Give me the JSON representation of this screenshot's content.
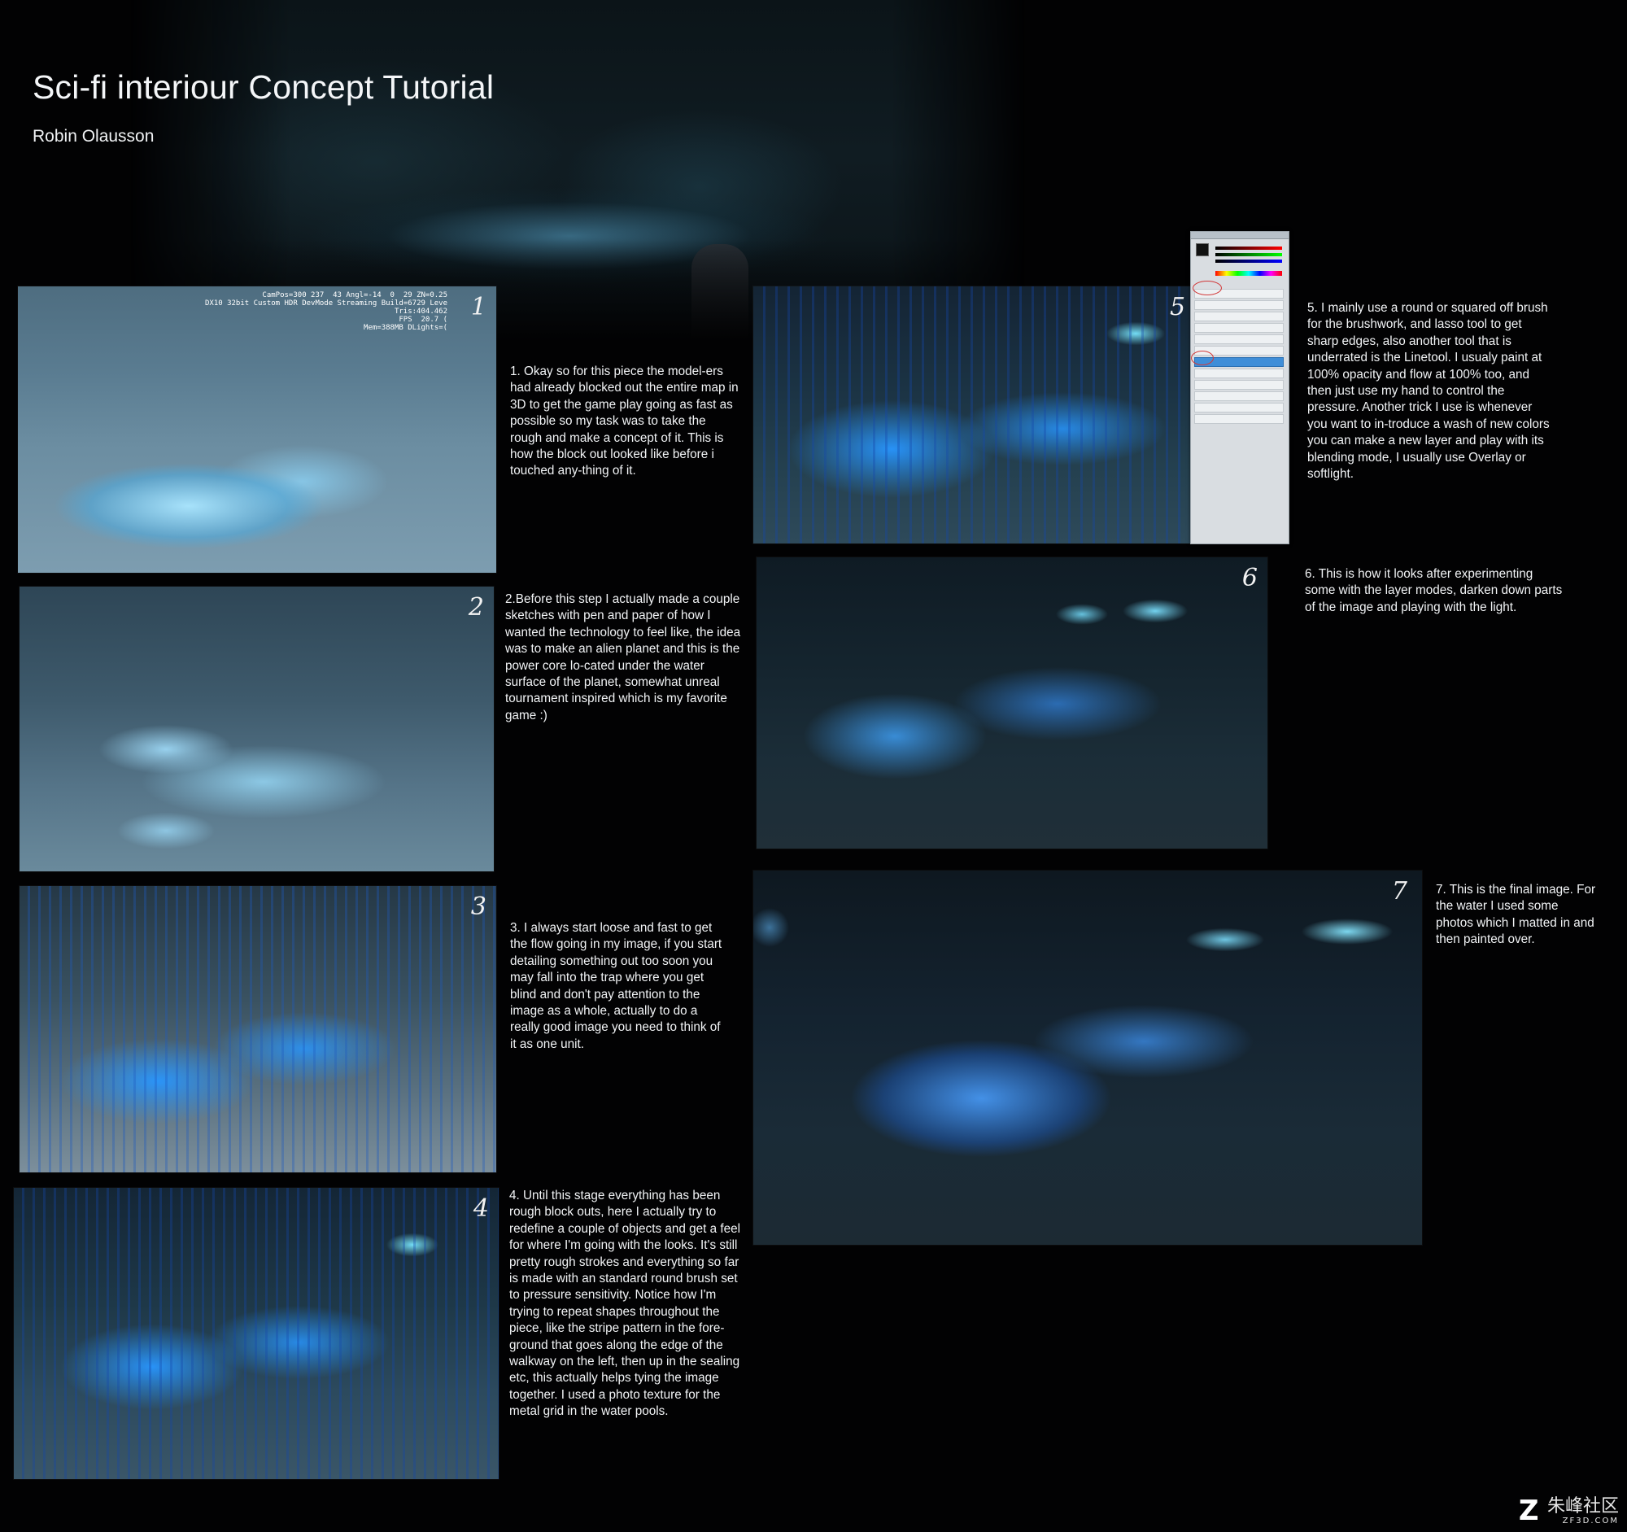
{
  "header": {
    "title": "Sci-fi interiour Concept Tutorial",
    "author": "Robin Olausson"
  },
  "panels": [
    {
      "number": "1",
      "hud": "CamPos=300 237  43 Angl=-14  0  29 ZN=0.25\nDX10 32bit Custom HDR DevMode Streaming Build=6729 Leve\nTris:404.462\nFPS  20.7 (\nMem=388MB DLights=(",
      "text": "1. Okay so for this piece the model-ers had already blocked out the entire map in 3D to get the game play going as fast as possible so my task was to take the rough and make a concept of it. This is how the block out looked like before i touched any-thing of it."
    },
    {
      "number": "2",
      "text": "2.Before this step I actually made a couple sketches with pen and paper of how I wanted the technology to feel like, the idea was to make an alien planet and this is the power core lo-cated under the water surface of the planet, somewhat unreal tournament inspired which is my favorite game :)"
    },
    {
      "number": "3",
      "text": "3. I always start loose and fast to get the flow going in my image, if you start detailing something out too soon you may fall into the trap where you get blind and don't pay attention to the image as a whole, actually to do a really good image you need to think of it as one unit."
    },
    {
      "number": "4",
      "text": "4. Until this stage everything has been rough block outs, here I actually try to redefine a couple of objects and get a feel for where I'm going with the looks. It's still pretty rough strokes and everything so far is made with an standard round brush set to pressure sensitivity. Notice how I'm trying to repeat shapes throughout the piece, like the stripe pattern in the fore-ground that goes along the edge of the walkway on the left, then up in the sealing etc, this actually helps tying the image together. I used a photo texture for the metal grid in the water pools."
    },
    {
      "number": "5",
      "text": "5. I mainly use a round or squared off brush for the brushwork, and lasso tool to get sharp edges, also another tool that is underrated is the Linetool. I usualy paint at 100% opacity and flow at 100% too, and then just use my hand to control the pressure. Another trick I use is whenever you want to in-troduce a wash of new colors you can make a new layer and play with its blending mode, I usually use Overlay or softlight."
    },
    {
      "number": "6",
      "text": "6. This is how it looks after experimenting some with the layer modes, darken down parts of the image and playing with the light."
    },
    {
      "number": "7",
      "text": "7. This is the final image. For the water I used some photos which I matted in and then painted over."
    }
  ],
  "watermark": {
    "mark": "Z",
    "name": "朱峰社区",
    "url": "ZF3D.COM"
  }
}
